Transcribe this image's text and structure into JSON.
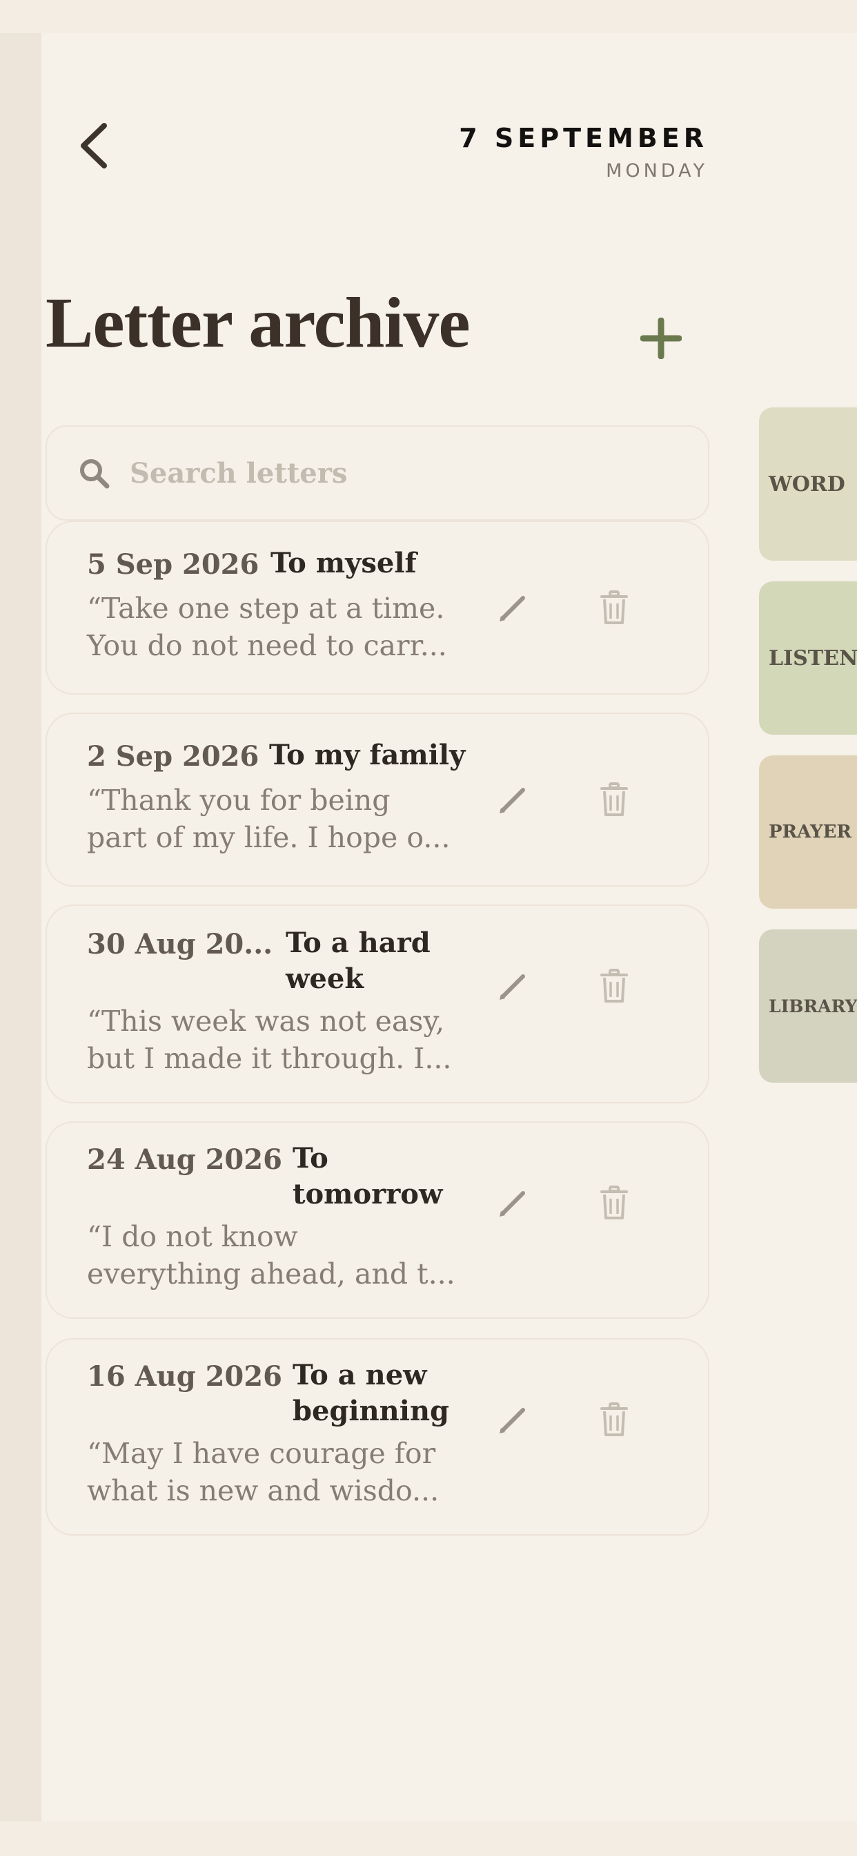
{
  "header": {
    "date": "7 SEPTEMBER",
    "weekday": "MONDAY",
    "back_icon": "chevron-left-icon"
  },
  "page_title": "Letter archive",
  "add_icon": "plus-icon",
  "search": {
    "placeholder": "Search letters",
    "value": "",
    "icon": "search-icon"
  },
  "letters": [
    {
      "date": "5 Sep 2026",
      "title": "To myself",
      "excerpt_line1": "“Take one step at a time.",
      "excerpt_line2": "You do not need to carr..."
    },
    {
      "date": "2 Sep 2026",
      "title": "To my family",
      "excerpt_line1": "“Thank you for being",
      "excerpt_line2": "part of my life. I hope o..."
    },
    {
      "date": "30 Aug 20...",
      "title_line1": "To a hard",
      "title_line2": "week",
      "excerpt_line1": "“This week was not easy,",
      "excerpt_line2": "but I made it through. I..."
    },
    {
      "date": "24 Aug 2026",
      "title_line1": "To",
      "title_line2": "tomorrow",
      "excerpt_line1": "“I do not know",
      "excerpt_line2": "everything ahead, and t..."
    },
    {
      "date": "16 Aug 2026",
      "title_line1": "To a new",
      "title_line2": "beginning",
      "excerpt_line1": "“May I have courage for",
      "excerpt_line2": "what is new and wisdo..."
    }
  ],
  "card_icons": {
    "edit": "pencil-icon",
    "delete": "trash-icon"
  },
  "side_tabs": [
    {
      "label": "WORD",
      "color": "#DEDCC2"
    },
    {
      "label": "LISTEN",
      "color": "#D2D8B8"
    },
    {
      "label": "PRAYER",
      "color": "#E0D3B8"
    },
    {
      "label": "LIBRARY",
      "color": "#D3D3C0"
    }
  ],
  "colors": {
    "background": "#F6F1E9",
    "title": "#3b3128",
    "accent_green": "#6b7a4e",
    "icon_gray": "#9a948b",
    "trash_gray": "#C4BDB2"
  }
}
